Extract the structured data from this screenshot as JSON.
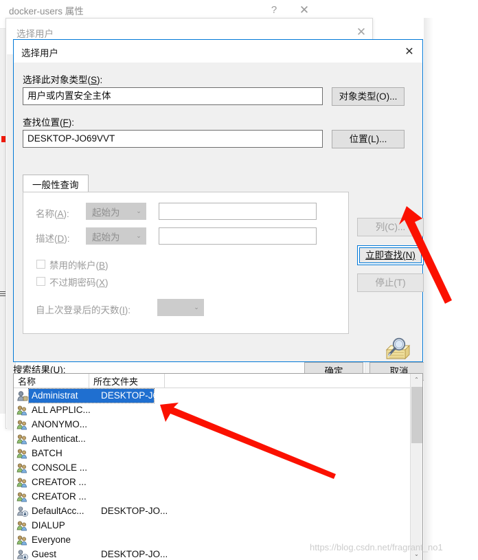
{
  "background_window": {
    "title": "docker-users 属性",
    "help_icon": "?",
    "close_icon": "✕"
  },
  "background_dialog": {
    "title": "选择用户",
    "close_icon": "✕"
  },
  "dialog": {
    "title": "选择用户",
    "close_icon": "✕",
    "object_type": {
      "label_prefix": "选择此对象类型(",
      "label_key": "S",
      "label_suffix": "):",
      "value": "用户或内置安全主体",
      "button": "对象类型(O)..."
    },
    "location": {
      "label_prefix": "查找位置(",
      "label_key": "F",
      "label_suffix": "):",
      "value": "DESKTOP-JO69VVT",
      "button": "位置(L)..."
    },
    "tabs": [
      {
        "label": "一般性查询",
        "active": true
      }
    ],
    "query": {
      "name_label_prefix": "名称(",
      "name_label_key": "A",
      "name_label_suffix": "):",
      "name_condition": "起始为",
      "name_value": "",
      "desc_label_prefix": "描述(",
      "desc_label_key": "D",
      "desc_label_suffix": "):",
      "desc_condition": "起始为",
      "desc_value": "",
      "disabled_accounts_prefix": "禁用的帐户(",
      "disabled_accounts_key": "B",
      "disabled_accounts_suffix": ")",
      "disabled_accounts_checked": false,
      "password_never_expires_prefix": "不过期密码(",
      "password_never_expires_key": "X",
      "password_never_expires_suffix": ")",
      "password_never_expires_checked": false,
      "days_since_logon_prefix": "自上次登录后的天数(",
      "days_since_logon_key": "I",
      "days_since_logon_suffix": "):",
      "days_since_logon_value": "",
      "dropdown_arrow": "⌄"
    },
    "side_buttons": [
      {
        "label": "列(C)...",
        "name": "columns-button",
        "state": "disabled"
      },
      {
        "label": "立即查找(N)",
        "name": "find-now-button",
        "state": "focused"
      },
      {
        "label": "停止(T)",
        "name": "stop-button",
        "state": "disabled"
      }
    ],
    "search_icon_name": "search-folder-icon",
    "footer_buttons": [
      {
        "label": "确定",
        "name": "ok-button"
      },
      {
        "label": "取消",
        "name": "cancel-button"
      }
    ]
  },
  "results": {
    "label_prefix": "搜索结果(",
    "label_key": "U",
    "label_suffix": "):",
    "columns": [
      "名称",
      "所在文件夹"
    ],
    "rows": [
      {
        "icon": "user-icon",
        "name": "Administrat",
        "folder": "DESKTOP-JO...",
        "selected": true
      },
      {
        "icon": "group-icon",
        "name": "ALL APPLIC...",
        "folder": "",
        "selected": false
      },
      {
        "icon": "group-icon",
        "name": "ANONYMO...",
        "folder": "",
        "selected": false
      },
      {
        "icon": "group-icon",
        "name": "Authenticat...",
        "folder": "",
        "selected": false
      },
      {
        "icon": "group-icon",
        "name": "BATCH",
        "folder": "",
        "selected": false
      },
      {
        "icon": "group-icon",
        "name": "CONSOLE ...",
        "folder": "",
        "selected": false
      },
      {
        "icon": "group-icon",
        "name": "CREATOR ...",
        "folder": "",
        "selected": false
      },
      {
        "icon": "group-icon",
        "name": "CREATOR ...",
        "folder": "",
        "selected": false
      },
      {
        "icon": "user-disabled-icon",
        "name": "DefaultAcc...",
        "folder": "DESKTOP-JO...",
        "selected": false
      },
      {
        "icon": "group-icon",
        "name": "DIALUP",
        "folder": "",
        "selected": false
      },
      {
        "icon": "group-icon",
        "name": "Everyone",
        "folder": "",
        "selected": false
      },
      {
        "icon": "user-disabled-icon",
        "name": "Guest",
        "folder": "DESKTOP-JO...",
        "selected": false
      }
    ],
    "scroll_up_icon": "⌃",
    "scroll_down_icon": "⌄"
  },
  "watermark": "https://blog.csdn.net/fragrant_no1",
  "colors": {
    "accent": "#0078d7",
    "selection": "#1f6fd0",
    "annotation_arrow": "#fb1100",
    "dialog_face": "#f0f0f0",
    "button_face": "#e1e1e1"
  }
}
